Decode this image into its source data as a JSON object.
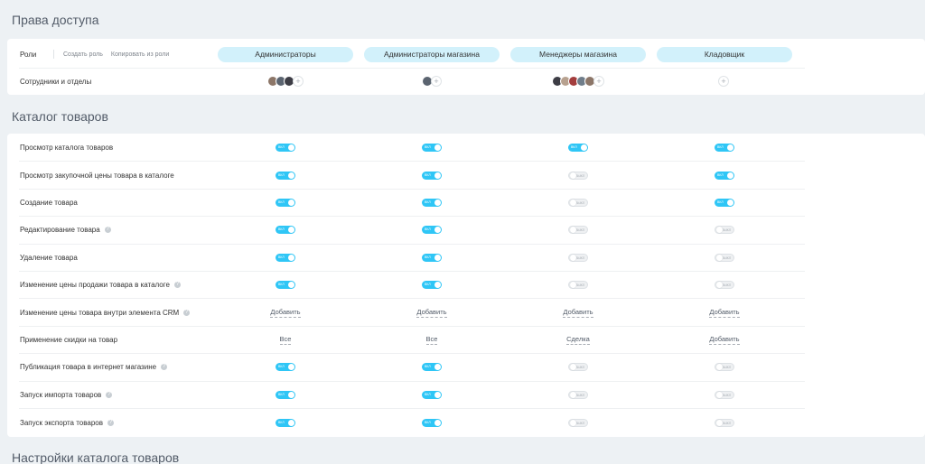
{
  "sections": {
    "access": "Права доступа",
    "catalog": "Каталог товаров",
    "catalog_settings": "Настройки каталога товаров"
  },
  "roles_row": {
    "label": "Роли",
    "create_role": "Создать роль",
    "copy_from_role": "Копировать из роли"
  },
  "roles": [
    "Администраторы",
    "Администраторы магазина",
    "Менеджеры магазина",
    "Кладовщик"
  ],
  "employees_row": {
    "label": "Сотрудники и отделы",
    "avatar_counts": [
      3,
      1,
      5,
      0
    ],
    "add": "+"
  },
  "toggle_text": {
    "on": "ВКЛ",
    "off": "ВЫКЛ"
  },
  "colors": {
    "accent": "#2fc6f6",
    "role_pill": "#d2f1fb"
  },
  "permissions": [
    {
      "label": "Просмотр каталога товаров",
      "help": false,
      "values": [
        "on",
        "on",
        "on",
        "on"
      ]
    },
    {
      "label": "Просмотр закупочной цены товара в каталоге",
      "help": false,
      "values": [
        "on",
        "on",
        "off",
        "on"
      ]
    },
    {
      "label": "Создание товара",
      "help": false,
      "values": [
        "on",
        "on",
        "off",
        "on"
      ]
    },
    {
      "label": "Редактирование товара",
      "help": true,
      "values": [
        "on",
        "on",
        "off",
        "off"
      ]
    },
    {
      "label": "Удаление товара",
      "help": false,
      "values": [
        "on",
        "on",
        "off",
        "off"
      ]
    },
    {
      "label": "Изменение цены продажи товара в каталоге",
      "help": true,
      "values": [
        "on",
        "on",
        "off",
        "off"
      ]
    },
    {
      "label": "Изменение цены товара внутри элемента CRM",
      "help": true,
      "values": [
        "Добавить",
        "Добавить",
        "Добавить",
        "Добавить"
      ]
    },
    {
      "label": "Применение скидки на товар",
      "help": false,
      "values": [
        "Все",
        "Все",
        "Сделка",
        "Добавить"
      ]
    },
    {
      "label": "Публикация товара в интернет магазине",
      "help": true,
      "values": [
        "on",
        "on",
        "off",
        "off"
      ]
    },
    {
      "label": "Запуск импорта товаров",
      "help": true,
      "values": [
        "on",
        "on",
        "off",
        "off"
      ]
    },
    {
      "label": "Запуск экспорта товаров",
      "help": true,
      "values": [
        "on",
        "on",
        "off",
        "off"
      ]
    }
  ]
}
